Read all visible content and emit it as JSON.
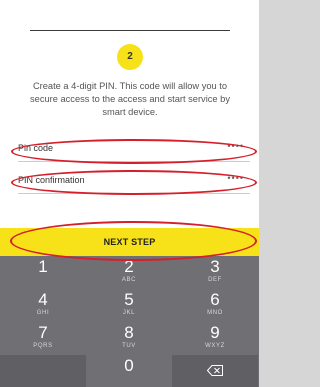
{
  "step": {
    "number": "2",
    "instructions": "Create a 4-digit PIN. This code will allow you to secure access to the access and start service by smart device."
  },
  "fields": [
    {
      "label": "Pin code",
      "value": "••••"
    },
    {
      "label": "PIN confirmation",
      "value": "••••"
    }
  ],
  "next_button": {
    "label": "NEXT STEP"
  },
  "keypad": {
    "keys": [
      {
        "digit": "1",
        "letters": ""
      },
      {
        "digit": "2",
        "letters": "ABC"
      },
      {
        "digit": "3",
        "letters": "DEF"
      },
      {
        "digit": "4",
        "letters": "GHI"
      },
      {
        "digit": "5",
        "letters": "JKL"
      },
      {
        "digit": "6",
        "letters": "MNO"
      },
      {
        "digit": "7",
        "letters": "PQRS"
      },
      {
        "digit": "8",
        "letters": "TUV"
      },
      {
        "digit": "9",
        "letters": "WXYZ"
      },
      {
        "digit": "0",
        "letters": ""
      }
    ],
    "backspace_icon": "backspace-icon"
  },
  "colors": {
    "accent": "#f7e21a",
    "highlight": "#d51f2a",
    "keypad": "#6f6f74"
  }
}
